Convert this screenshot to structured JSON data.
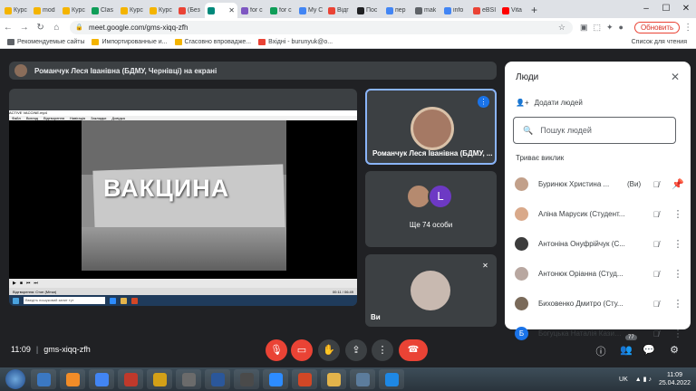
{
  "browser": {
    "tabs": [
      {
        "label": "Курс",
        "color": "#f4b400",
        "active": false
      },
      {
        "label": "mod",
        "color": "#f4b400",
        "active": false
      },
      {
        "label": "Курс",
        "color": "#f4b400",
        "active": false
      },
      {
        "label": "Clas",
        "color": "#0f9d58",
        "active": false
      },
      {
        "label": "Курс",
        "color": "#f4b400",
        "active": false
      },
      {
        "label": "Курс",
        "color": "#f4b400",
        "active": false
      },
      {
        "label": "(Без",
        "color": "#ea4335",
        "active": false
      },
      {
        "label": "",
        "color": "#00897b",
        "active": true
      },
      {
        "label": "for c",
        "color": "#7e57c2",
        "active": false
      },
      {
        "label": "for c",
        "color": "#0f9d58",
        "active": false
      },
      {
        "label": "My C",
        "color": "#4285f4",
        "active": false
      },
      {
        "label": "Відг",
        "color": "#ea4335",
        "active": false
      },
      {
        "label": "Пос",
        "color": "#202124",
        "active": false
      },
      {
        "label": "пер",
        "color": "#4285f4",
        "active": false
      },
      {
        "label": "mak",
        "color": "#5f6368",
        "active": false
      },
      {
        "label": "info",
        "color": "#4285f4",
        "active": false
      },
      {
        "label": "eBSI",
        "color": "#ea4335",
        "active": false
      },
      {
        "label": "Vita",
        "color": "#ff0000",
        "active": false
      }
    ],
    "new_tab": "+",
    "url": "meet.google.com/gms-xiqq-zfh",
    "update_label": "Обновить",
    "bookmarks": [
      {
        "label": "Рекомендуемые сайты",
        "color": "#5f6368"
      },
      {
        "label": "Импортированные и...",
        "color": "#f4b400"
      },
      {
        "label": "Сгасовно впроваджe...",
        "color": "#f4b400"
      },
      {
        "label": "Вхідні - burunyuk@o...",
        "color": "#ea4335"
      }
    ],
    "reading_list": "Список для чтения"
  },
  "meet": {
    "presenter_banner": "Романчук Леся Іванівна (БДМУ, Чернівці) на екрані",
    "shared_word": "ВАКЦИНА",
    "inner_window_title": "ACTIVE VACCINE.mp4",
    "inner_menu": [
      "Файл",
      "Вигляд",
      "Відтворення",
      "Навігація",
      "Закладки",
      "Довідка"
    ],
    "inner_status_left": "Відтворення: Стоп (Мітки)",
    "inner_status_right": "00:11 / 06:49",
    "inner_search": "Введіть пошуковий запит тут",
    "tiles": [
      {
        "name": "Романчук Леся Іванівна (БДМУ, ..."
      },
      {
        "more": "Ще 74 особи",
        "letter": "L"
      },
      {
        "name": "Ви"
      }
    ],
    "meeting_time": "11:09",
    "meeting_code": "gms-xiqq-zfh",
    "participant_badge": "77"
  },
  "panel": {
    "title": "Люди",
    "add_people": "Додати людей",
    "search_placeholder": "Пошук людей",
    "section": "Триває виклик",
    "people": [
      {
        "name": "Буринюк Христина ...",
        "suffix": "(Ви)",
        "color": "#c2a08a",
        "initial": ""
      },
      {
        "name": "Аліна Марусик (Студент...",
        "suffix": "",
        "color": "#d9a98a",
        "initial": ""
      },
      {
        "name": "Антоніна Онуфрійчук (С...",
        "suffix": "",
        "color": "#3c3c3c",
        "initial": ""
      },
      {
        "name": "Антонюк Оріанна (Студ...",
        "suffix": "",
        "color": "#b8a7a0",
        "initial": ""
      },
      {
        "name": "Биховенко Дмитро (Сту...",
        "suffix": "",
        "color": "#7a6a5a",
        "initial": ""
      },
      {
        "name": "Богуцька Наталія Казим...",
        "suffix": "",
        "color": "#1a73e8",
        "initial": "Б"
      }
    ]
  },
  "taskbar": {
    "lang": "UK",
    "time": "11:09",
    "date": "25.04.2022",
    "apps": [
      "#3b78c2",
      "#f28c28",
      "#4285f4",
      "#c0392b",
      "#d4a017",
      "#6b6b6b",
      "#2b579a",
      "#4a4a4a",
      "#2d8cff",
      "#d24726",
      "#e4b44b",
      "#5c7c9c",
      "#1e88e5"
    ]
  }
}
